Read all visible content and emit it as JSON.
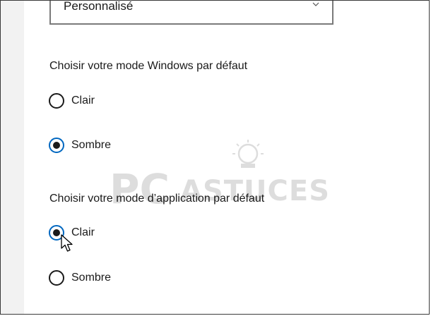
{
  "theme_dropdown": {
    "value": "Personnalisé"
  },
  "windows_mode": {
    "title": "Choisir votre mode Windows par défaut",
    "options": [
      {
        "label": "Clair",
        "checked": false
      },
      {
        "label": "Sombre",
        "checked": true
      }
    ]
  },
  "app_mode": {
    "title": "Choisir votre mode d’application par défaut",
    "options": [
      {
        "label": "Clair",
        "checked": true
      },
      {
        "label": "Sombre",
        "checked": false
      }
    ]
  },
  "watermark": {
    "text": "PC ASTUCES"
  },
  "icons": {
    "dropdown": "chevron-down-icon",
    "watermark": "pcastuces-logo-icon",
    "cursor": "mouse-cursor-icon"
  }
}
